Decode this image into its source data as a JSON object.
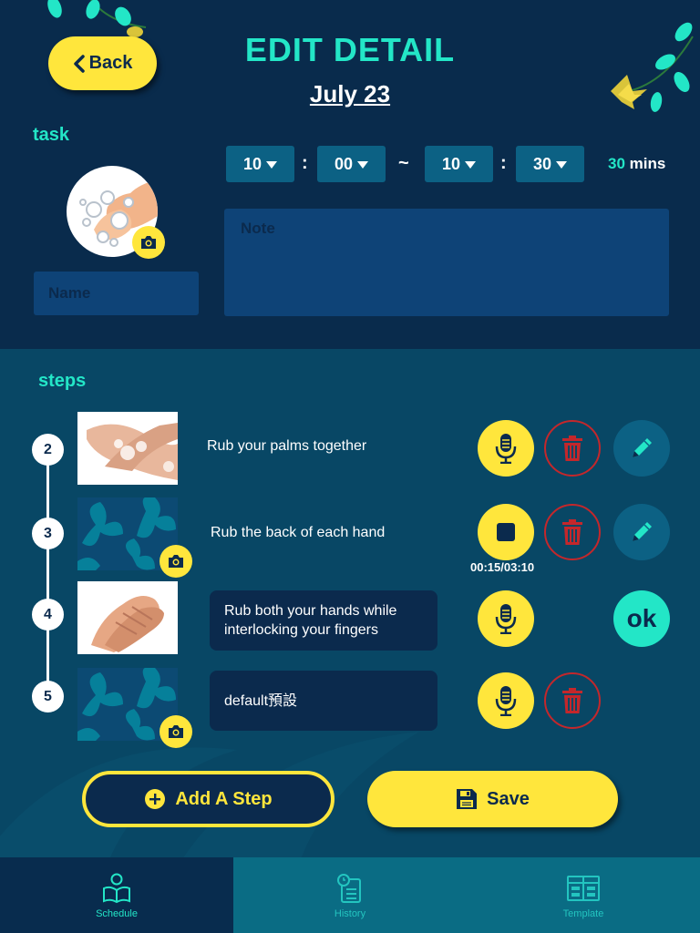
{
  "header": {
    "back_label": "Back",
    "title": "EDIT DETAIL",
    "date": "July 23"
  },
  "task": {
    "section_label": "task",
    "name_placeholder": "Name",
    "note_placeholder": "Note",
    "start_hour": "10",
    "start_minute": "00",
    "range_separator": "~",
    "time_colon": ":",
    "end_hour": "10",
    "end_minute": "30",
    "duration_value": "30",
    "duration_unit": "mins"
  },
  "steps": {
    "section_label": "steps",
    "items": [
      {
        "number": "2",
        "text": "Rub your palms together",
        "mic_state": "mic",
        "has_delete": true,
        "has_edit": true
      },
      {
        "number": "3",
        "text": "Rub the back of each hand",
        "mic_state": "recording",
        "record_time": "00:15/03:10",
        "has_delete": true,
        "has_edit": true
      },
      {
        "number": "4",
        "text": "Rub both your hands while interlocking your fingers",
        "mic_state": "mic",
        "editing": true,
        "ok_label": "ok"
      },
      {
        "number": "5",
        "text": "default預設",
        "mic_state": "mic",
        "has_delete": true
      }
    ]
  },
  "actions": {
    "add_step_label": "Add A Step",
    "save_label": "Save"
  },
  "tabbar": {
    "tabs": [
      {
        "label": "Schedule",
        "active": true
      },
      {
        "label": "History",
        "active": false
      },
      {
        "label": "Template",
        "active": false
      }
    ]
  },
  "colors": {
    "accent_yellow": "#ffe63c",
    "accent_teal": "#23e6c7",
    "delete_red": "#c4272b",
    "header_bg": "#092b4c",
    "steps_bg": "#084765",
    "tabbar_bg": "#0a6c84"
  }
}
